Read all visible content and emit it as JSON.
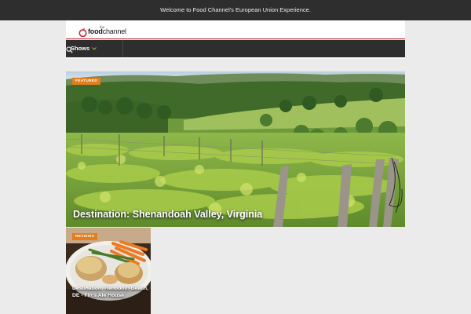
{
  "topbar": {
    "message": "Welcome to Food Channel's European Union Experience."
  },
  "header": {
    "logo": {
      "the": "the",
      "food": "food",
      "channel": "channel"
    }
  },
  "nav": {
    "shows_label": "Shows",
    "search_icon": "search-icon",
    "dropdown_icon": "chevron-down-icon"
  },
  "featured": {
    "badge": "FEATURED",
    "title": "Destination: Shenandoah Valley, Virginia"
  },
  "cards": [
    {
      "badge": "REVIEWS",
      "title": "Destination: Rehoboth Beach, DE - Fin's Ale House"
    }
  ],
  "colors": {
    "accent": "#e47e1c",
    "brand_red": "#c8252c",
    "dark_bar": "#2e2e2e"
  }
}
